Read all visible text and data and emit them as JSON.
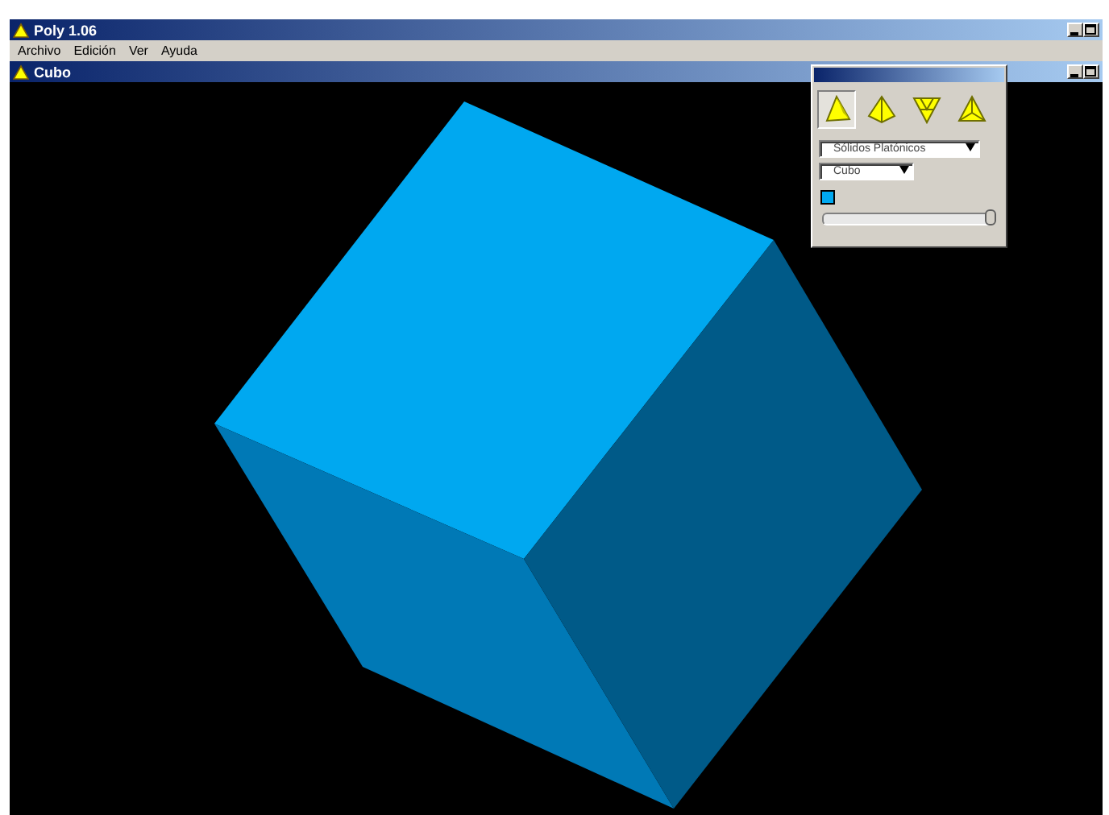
{
  "window": {
    "title": "Poly 1.06"
  },
  "menu": [
    "Archivo",
    "Edición",
    "Ver",
    "Ayuda"
  ],
  "document": {
    "title": "Cubo"
  },
  "tool_panel": {
    "modes": [
      {
        "selected": true
      },
      {
        "selected": false
      },
      {
        "selected": false
      },
      {
        "selected": false
      }
    ],
    "family": "Sólidos Platónicos",
    "solid": "Cubo",
    "color": "#00a8f0",
    "slider": {
      "level": 1.0
    }
  }
}
